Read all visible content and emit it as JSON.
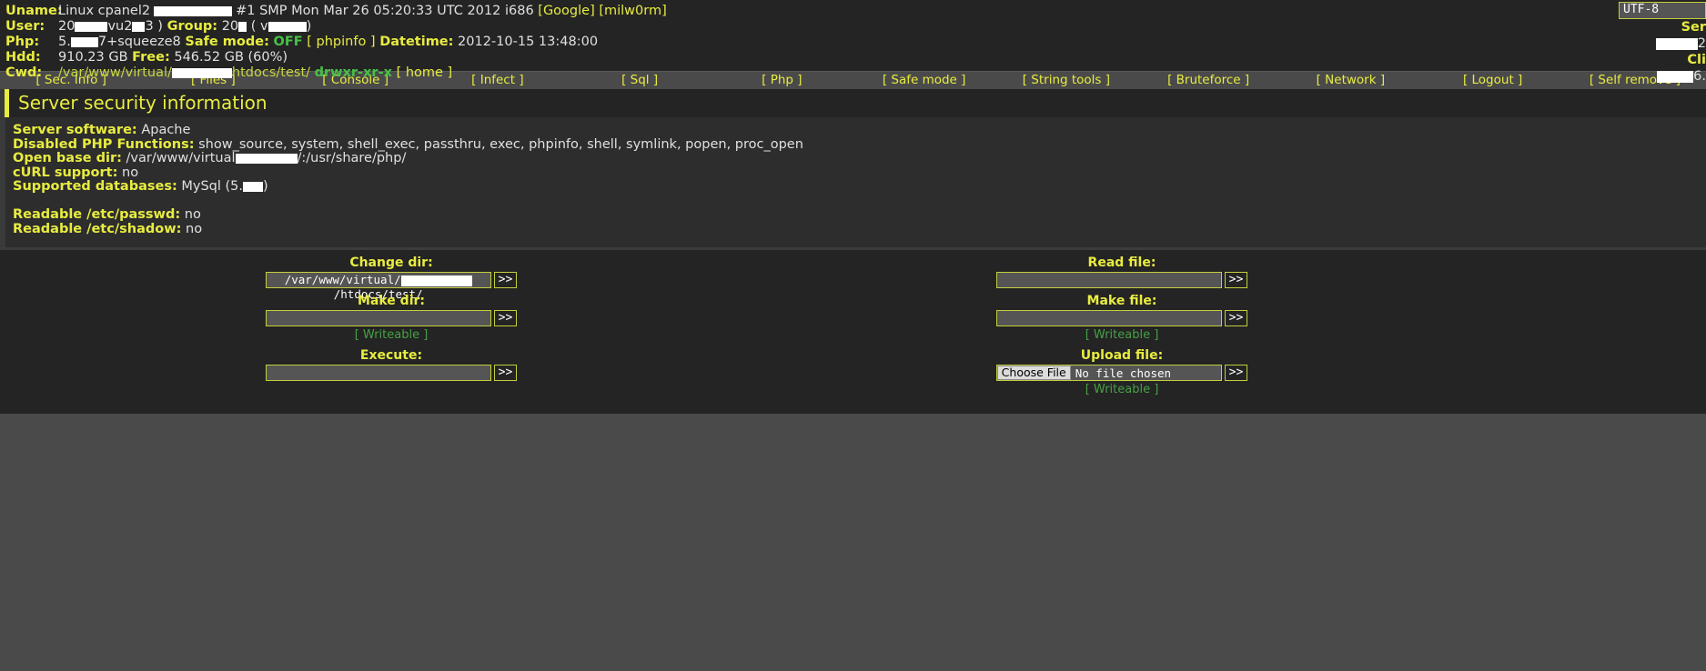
{
  "header": {
    "rows": [
      {
        "label": "Uname:",
        "value_pre": "Linux cpanel2",
        "value_post": "#1 SMP Mon Mar 26 05:20:33 UTC 2012 i686",
        "links": [
          "[Google]",
          "[milw0rm]"
        ]
      },
      {
        "label": "User:",
        "user_pre": "20",
        "user_mid": "vu2",
        "user_post": "3 )",
        "group_label": "Group:",
        "group_pre": "20",
        "group_post": "( v",
        "group_end": ")"
      },
      {
        "label": "Php:",
        "php_pre": "5.",
        "php_post": "7+squeeze8",
        "safe_mode_label": "Safe mode:",
        "safe_mode_value": "OFF",
        "phpinfo_link": "[ phpinfo ]",
        "datetime_label": "Datetime:",
        "datetime_value": "2012-10-15 13:48:00"
      },
      {
        "label": "Hdd:",
        "hdd_value": "910.23 GB",
        "free_label": "Free:",
        "free_value": "546.52 GB (60%)"
      },
      {
        "label": "Cwd:",
        "cwd_pre": "/var/www/virtual/",
        "cwd_post": "htdocs/test/",
        "perms": "drwxr-xr-x",
        "home_link": "[ home ]"
      }
    ],
    "charset": "UTF-8",
    "server_label": "Ser",
    "server_value": "2",
    "client_label": "Cli",
    "client_value": "6."
  },
  "nav": {
    "items": [
      {
        "label": "[ Sec. Info ]",
        "name": "sec-info"
      },
      {
        "label": "[ Files ]",
        "name": "files"
      },
      {
        "label": "[ Console ]",
        "name": "console"
      },
      {
        "label": "[ Infect ]",
        "name": "infect"
      },
      {
        "label": "[ Sql ]",
        "name": "sql"
      },
      {
        "label": "[ Php ]",
        "name": "php"
      },
      {
        "label": "[ Safe mode ]",
        "name": "safe-mode"
      },
      {
        "label": "[ String tools ]",
        "name": "string-tools"
      },
      {
        "label": "[ Bruteforce ]",
        "name": "bruteforce"
      },
      {
        "label": "[ Network ]",
        "name": "network"
      },
      {
        "label": "[ Logout ]",
        "name": "logout"
      },
      {
        "label": "[ Self remove ]",
        "name": "self-remove"
      }
    ]
  },
  "panel": {
    "title": "Server security information",
    "server_software_label": "Server software:",
    "server_software_value": "Apache",
    "disabled_php_label": "Disabled PHP Functions:",
    "disabled_php_value": "show_source, system, shell_exec, passthru, exec, phpinfo, shell, symlink, popen, proc_open",
    "open_base_dir_label": "Open base dir:",
    "open_base_dir_pre": "/var/www/virtual",
    "open_base_dir_post": "/:/usr/share/php/",
    "curl_label": "cURL support:",
    "curl_value": "no",
    "databases_label": "Supported databases:",
    "databases_pre": "MySql (5.",
    "databases_post": ")",
    "passwd_label": "Readable /etc/passwd:",
    "passwd_value": "no",
    "shadow_label": "Readable /etc/shadow:",
    "shadow_value": "no"
  },
  "forms": {
    "left": {
      "change_dir_label": "Change dir:",
      "change_dir_value_pre": "/var/www/virtual/",
      "change_dir_value_post": "/htdocs/test/",
      "change_dir_full": "/var/www/virtual/          /htdocs/test/",
      "make_dir_label": "Make dir:",
      "make_dir_value": "",
      "make_dir_writeable": "[ Writeable ]",
      "execute_label": "Execute:",
      "execute_value": "",
      "submit_label": ">>"
    },
    "right": {
      "read_file_label": "Read file:",
      "read_file_value": "",
      "make_file_label": "Make file:",
      "make_file_value": "",
      "make_file_writeable": "[ Writeable ]",
      "upload_file_label": "Upload file:",
      "choose_file_label": "Choose File",
      "no_file_chosen": "No file chosen",
      "upload_writeable": "[ Writeable ]",
      "submit_label": ">>"
    }
  },
  "colors": {
    "accent": "#e8ec40",
    "green": "#46c246",
    "bg_dark": "#242424",
    "bg_panel": "#2d2d2d",
    "bg_nav": "#4a4a4a"
  }
}
